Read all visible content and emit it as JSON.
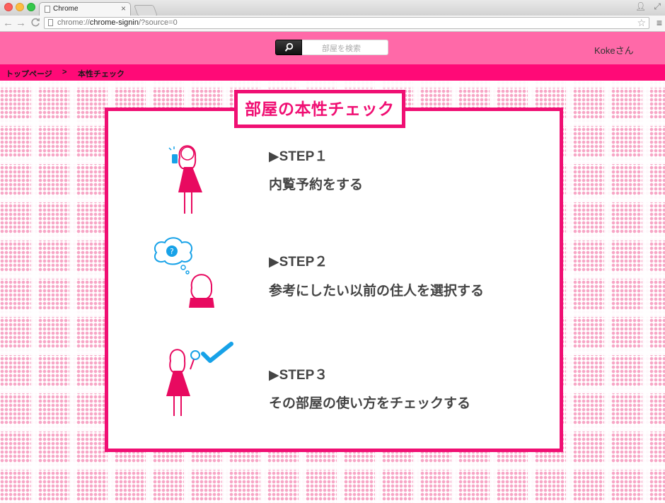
{
  "browser": {
    "tab_title": "Chrome",
    "tab_close": "×",
    "url_prefix": "chrome://",
    "url_host": "chrome-signin",
    "url_rest": "/?source=0",
    "nav_back": "←",
    "nav_forward": "→",
    "nav_reload": "C",
    "star": "☆",
    "menu": "≡"
  },
  "header": {
    "search_placeholder": "部屋を検索",
    "user_name": "Kokeさん",
    "bg_color": "#ff69a8"
  },
  "breadcrumb": {
    "home": "トップページ",
    "separator": ">",
    "current": "本性チェック",
    "bg_color": "#ff0a77"
  },
  "main": {
    "title": "部屋の本性チェック",
    "accent_color": "#f00f73",
    "steps": [
      {
        "heading": "▶STEP１",
        "text": "内覧予約をする",
        "icon": "girl-phone-icon"
      },
      {
        "heading": "▶STEP２",
        "text": "参考にしたい以前の住人を選択する",
        "icon": "girl-thinking-icon"
      },
      {
        "heading": "▶STEP３",
        "text": "その部屋の使い方をチェックする",
        "icon": "girl-magnifier-check-icon"
      }
    ]
  }
}
